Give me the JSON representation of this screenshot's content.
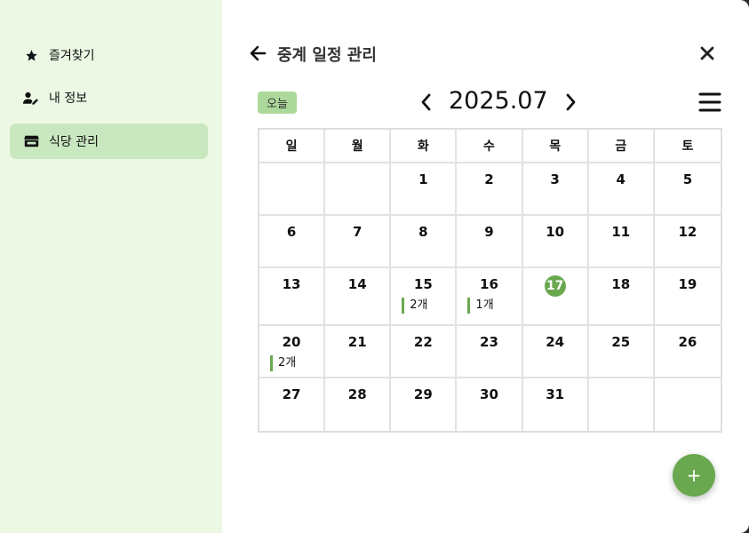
{
  "sidebar": {
    "items": [
      {
        "label": "즐겨찾기",
        "icon": "star-icon"
      },
      {
        "label": "내 정보",
        "icon": "user-edit-icon"
      },
      {
        "label": "식당 관리",
        "icon": "store-icon",
        "active": true
      }
    ]
  },
  "header": {
    "title": "중계 일정 관리",
    "back_icon": "arrow-left-icon",
    "close_icon": "close-icon"
  },
  "toolbar": {
    "today_label": "오늘",
    "month": "2025.07",
    "prev_icon": "chevron-left-icon",
    "next_icon": "chevron-right-icon",
    "menu_icon": "hamburger-menu-icon"
  },
  "calendar": {
    "weekdays": [
      "일",
      "월",
      "화",
      "수",
      "목",
      "금",
      "토"
    ],
    "weeks": [
      [
        {
          "day": ""
        },
        {
          "day": ""
        },
        {
          "day": "1"
        },
        {
          "day": "2"
        },
        {
          "day": "3"
        },
        {
          "day": "4"
        },
        {
          "day": "5"
        }
      ],
      [
        {
          "day": "6"
        },
        {
          "day": "7"
        },
        {
          "day": "8"
        },
        {
          "day": "9"
        },
        {
          "day": "10"
        },
        {
          "day": "11"
        },
        {
          "day": "12"
        }
      ],
      [
        {
          "day": "13"
        },
        {
          "day": "14"
        },
        {
          "day": "15",
          "events": "2개"
        },
        {
          "day": "16",
          "events": "1개"
        },
        {
          "day": "17",
          "today": true
        },
        {
          "day": "18"
        },
        {
          "day": "19"
        }
      ],
      [
        {
          "day": "20",
          "events": "2개"
        },
        {
          "day": "21"
        },
        {
          "day": "22"
        },
        {
          "day": "23"
        },
        {
          "day": "24"
        },
        {
          "day": "25"
        },
        {
          "day": "26"
        }
      ],
      [
        {
          "day": "27"
        },
        {
          "day": "28"
        },
        {
          "day": "29"
        },
        {
          "day": "30"
        },
        {
          "day": "31"
        },
        {
          "day": ""
        },
        {
          "day": ""
        }
      ]
    ]
  },
  "fab": {
    "label": "+"
  },
  "colors": {
    "sidebar_bg": "#ecf8e4",
    "sidebar_active": "#c9e8c0",
    "today_button": "#acd99b",
    "accent": "#6aa84f"
  }
}
